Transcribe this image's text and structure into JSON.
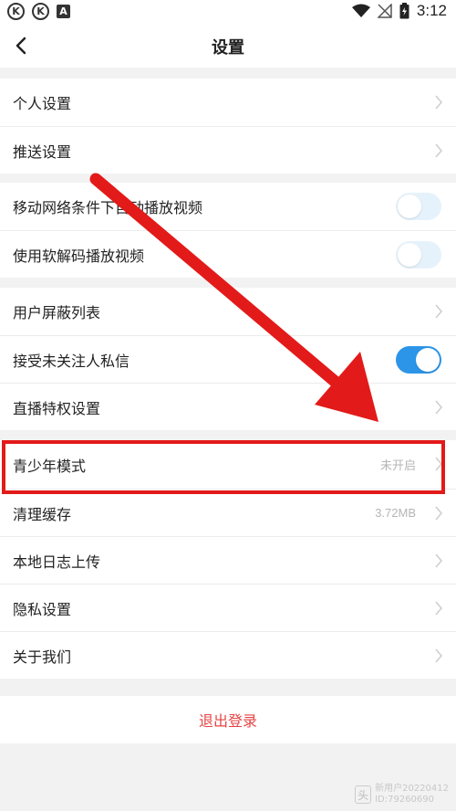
{
  "status": {
    "time": "3:12",
    "left_badges": [
      "K",
      "K",
      "A"
    ]
  },
  "header": {
    "title": "设置"
  },
  "groups": [
    {
      "items": [
        {
          "label": "个人设置",
          "kind": "chevron"
        },
        {
          "label": "推送设置",
          "kind": "chevron"
        }
      ]
    },
    {
      "items": [
        {
          "label": "移动网络条件下自动播放视频",
          "kind": "toggle",
          "on": false
        },
        {
          "label": "使用软解码播放视频",
          "kind": "toggle",
          "on": false
        }
      ]
    },
    {
      "items": [
        {
          "label": "用户屏蔽列表",
          "kind": "chevron"
        },
        {
          "label": "接受未关注人私信",
          "kind": "toggle",
          "on": true
        },
        {
          "label": "直播特权设置",
          "kind": "chevron"
        }
      ]
    },
    {
      "items": [
        {
          "label": "青少年模式",
          "kind": "chevron",
          "value": "未开启"
        },
        {
          "label": "清理缓存",
          "kind": "chevron",
          "value": "3.72MB"
        },
        {
          "label": "本地日志上传",
          "kind": "chevron"
        },
        {
          "label": "隐私设置",
          "kind": "chevron"
        },
        {
          "label": "关于我们",
          "kind": "chevron"
        }
      ]
    }
  ],
  "logout": {
    "label": "退出登录"
  },
  "watermark": {
    "line1": "新用户20220412",
    "line2": "ID:79260690",
    "logo": "头"
  },
  "colors": {
    "accent": "#2d95e8",
    "toggle_off": "#e6f2fb",
    "logout": "#e64545",
    "annotation": "#e31a1a"
  },
  "icons": {
    "back": "back-arrow-icon",
    "chevron": "chevron-right-icon",
    "wifi": "wifi-icon",
    "signal": "signal-icon",
    "battery": "battery-icon"
  }
}
